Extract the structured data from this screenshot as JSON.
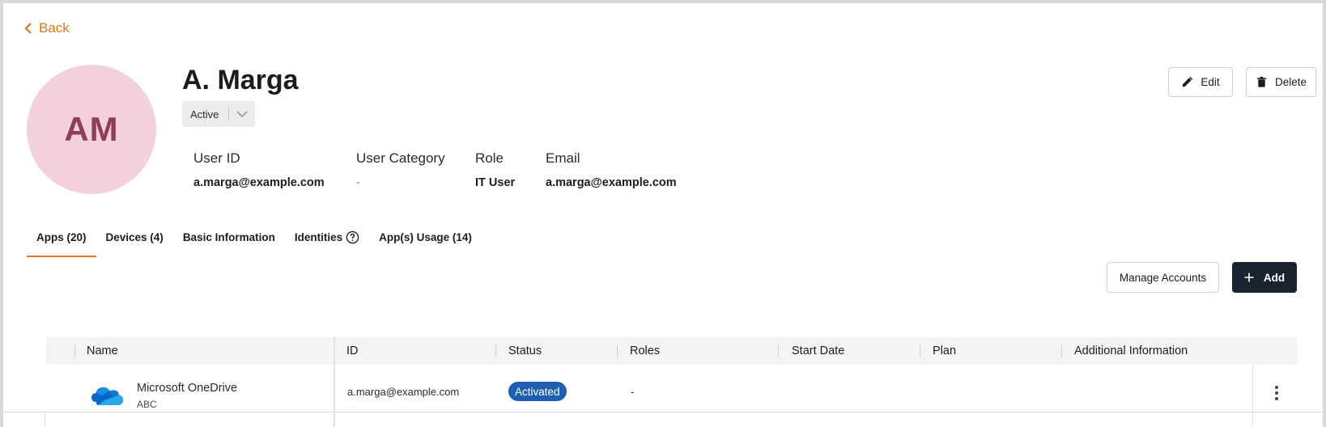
{
  "nav": {
    "back_label": "Back"
  },
  "user": {
    "initials": "AM",
    "name": "A. Marga",
    "status": "Active",
    "fields": [
      {
        "label": "User ID",
        "value": "a.marga@example.com"
      },
      {
        "label": "User Category",
        "value": "-"
      },
      {
        "label": "Role",
        "value": "IT User"
      },
      {
        "label": "Email",
        "value": "a.marga@example.com"
      }
    ]
  },
  "actions": {
    "edit_label": "Edit",
    "delete_label": "Delete"
  },
  "tabs": [
    {
      "label": "Apps (20)",
      "active": true
    },
    {
      "label": "Devices (4)",
      "active": false
    },
    {
      "label": "Basic Information",
      "active": false
    },
    {
      "label": "Identities",
      "active": false,
      "icon": "help-circle-icon"
    },
    {
      "label": "App(s) Usage (14)",
      "active": false
    }
  ],
  "toolbar": {
    "manage_label": "Manage Accounts",
    "add_label": "Add"
  },
  "table": {
    "columns": [
      "Name",
      "ID",
      "Status",
      "Roles",
      "Start Date",
      "Plan",
      "Additional Information"
    ],
    "rows": [
      {
        "app_name": "Microsoft OneDrive",
        "app_sub": "ABC",
        "icon": "onedrive-cloud-icon",
        "id": "a.marga@example.com",
        "status": "Activated",
        "roles": "-",
        "start_date": "",
        "plan": "",
        "additional": ""
      }
    ]
  },
  "colors": {
    "accent": "#e8741c",
    "avatar_bg": "#f3d1dc",
    "avatar_text": "#8e3e55",
    "primary_button": "#1c2330",
    "badge": "#1e5fb4"
  }
}
